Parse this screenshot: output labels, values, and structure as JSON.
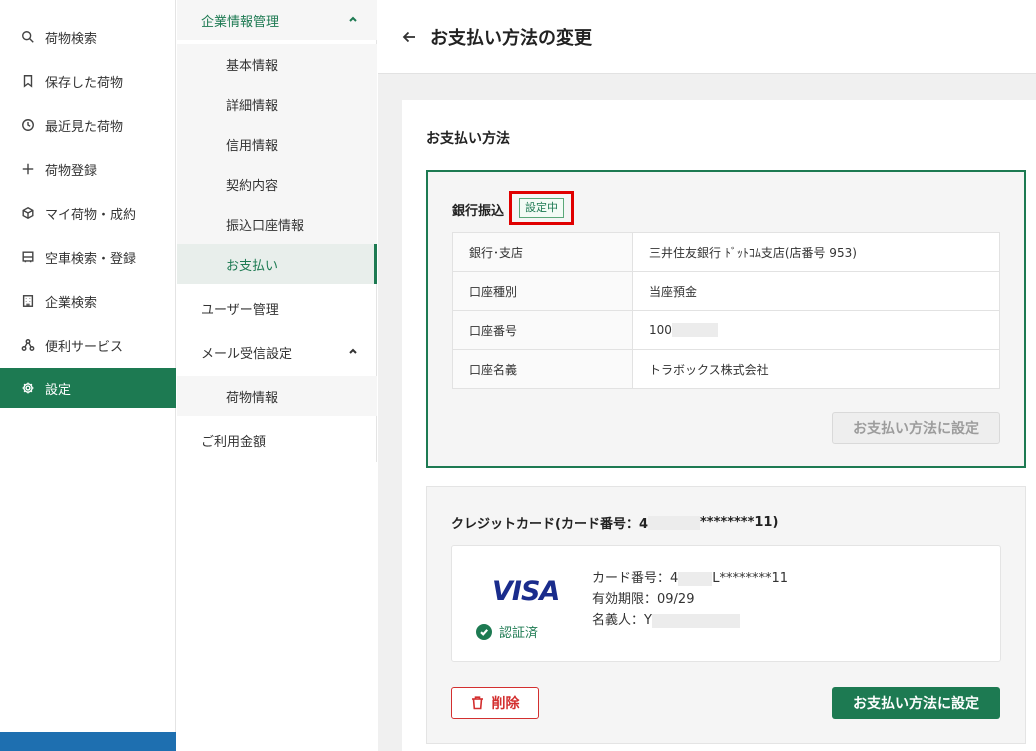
{
  "nav": {
    "items": [
      {
        "label": "荷物検索",
        "icon": "search-icon"
      },
      {
        "label": "保存した荷物",
        "icon": "bookmark-icon"
      },
      {
        "label": "最近見た荷物",
        "icon": "history-icon"
      },
      {
        "label": "荷物登録",
        "icon": "plus-icon"
      },
      {
        "label": "マイ荷物・成約",
        "icon": "box-icon"
      },
      {
        "label": "空車検索・登録",
        "icon": "truck-icon"
      },
      {
        "label": "企業検索",
        "icon": "building-icon"
      },
      {
        "label": "便利サービス",
        "icon": "network-icon"
      },
      {
        "label": "設定",
        "icon": "gear-icon"
      }
    ]
  },
  "submenu": {
    "company": "企業情報管理",
    "company_children": [
      "基本情報",
      "詳細情報",
      "信用情報",
      "契約内容",
      "振込口座情報",
      "お支払い"
    ],
    "user": "ユーザー管理",
    "mail": "メール受信設定",
    "mail_children": [
      "荷物情報"
    ],
    "usage": "ご利用金額"
  },
  "header": {
    "title": "お支払い方法の変更"
  },
  "payment": {
    "section_title": "お支払い方法",
    "bank": {
      "heading": "銀行振込",
      "badge": "設定中",
      "rows": [
        {
          "k": "銀行･支店",
          "v": "三井住友銀行 ﾄﾞｯﾄｺﾑ支店(店番号 953)"
        },
        {
          "k": "口座種別",
          "v": "当座預金"
        },
        {
          "k": "口座番号",
          "v": "100"
        },
        {
          "k": "口座名義",
          "v": "トラボックス株式会社"
        }
      ],
      "set_button": "お支払い方法に設定"
    },
    "credit": {
      "heading_prefix": "クレジットカード(カード番号：4",
      "heading_suffix": "********11)",
      "brand": "VISA",
      "verified": "認証済",
      "card_prefix": "カード番号：4",
      "card_suffix": "L********11",
      "expiry": "有効期限：09/29",
      "holder": "名義人：Y",
      "delete_button": "削除",
      "set_button": "お支払い方法に設定"
    }
  },
  "colors": {
    "accent": "#1d7a52",
    "danger": "#d32f2f",
    "highlight": "#e00000",
    "visa": "#1a2c8c"
  }
}
